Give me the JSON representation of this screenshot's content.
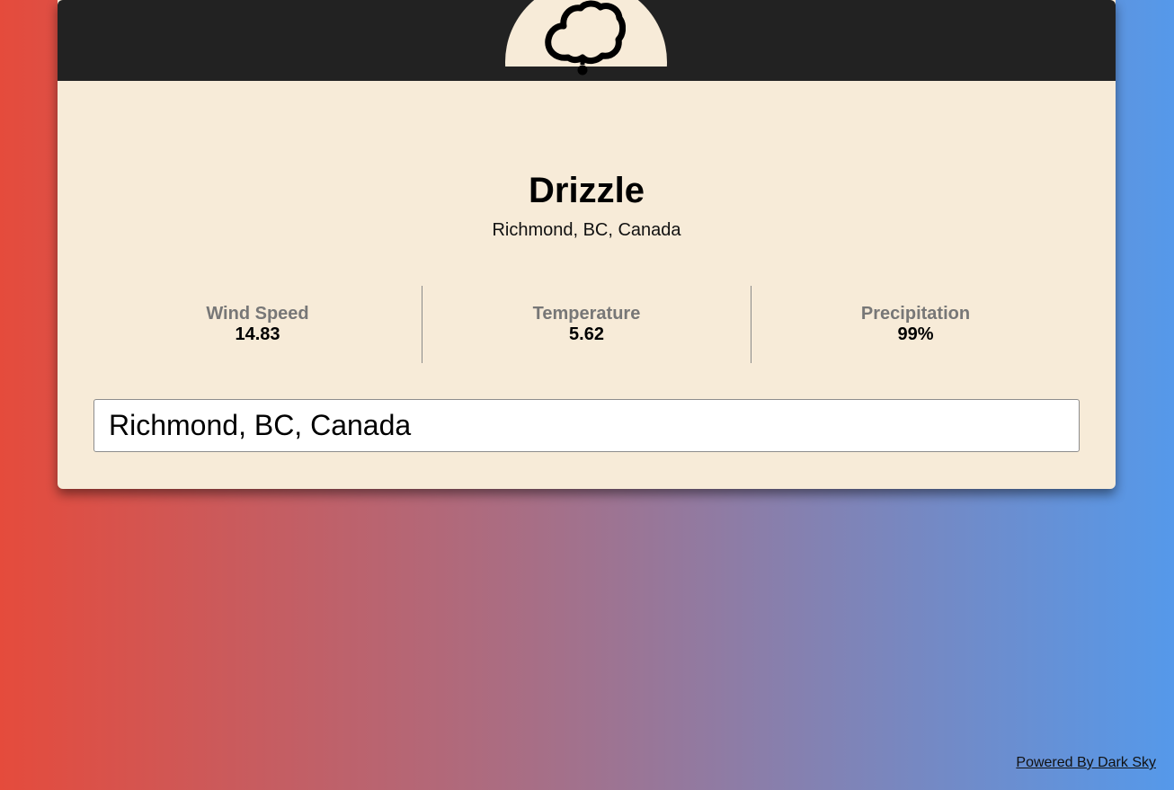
{
  "weather": {
    "icon": "cloud-drizzle-icon",
    "summary": "Drizzle",
    "location": "Richmond, BC, Canada"
  },
  "stats": [
    {
      "label": "Wind Speed",
      "value": "14.83"
    },
    {
      "label": "Temperature",
      "value": "5.62"
    },
    {
      "label": "Precipitation",
      "value": "99%"
    }
  ],
  "search": {
    "value": "Richmond, BC, Canada"
  },
  "footer": {
    "link_text": "Powered By Dark Sky"
  },
  "colors": {
    "header": "#222222",
    "card": "#f7ebd8",
    "gradient_left": "#e54b3c",
    "gradient_right": "#5599ea",
    "stat_label": "#777777"
  }
}
